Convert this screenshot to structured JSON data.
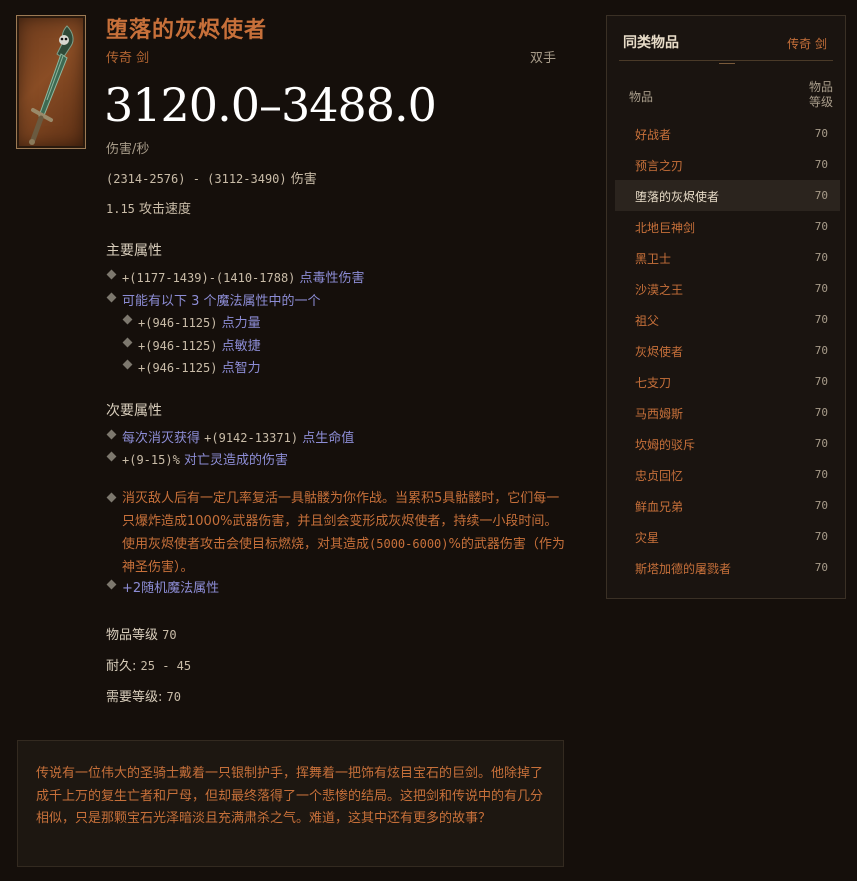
{
  "item": {
    "name": "堕落的灰烬使者",
    "subtype": "传奇 剑",
    "handedness": "双手",
    "dps": "3120.0–3488.0",
    "dps_label": "伤害/秒",
    "damage_range": "(2314-2576) - (3112-3490)",
    "damage_label": "伤害",
    "attack_speed": "1.15",
    "attack_speed_label": "攻击速度"
  },
  "primary": {
    "title": "主要属性",
    "poison": {
      "value": "+(1177-1439)-(1410-1788)",
      "text": "点毒性伤害"
    },
    "choice_text": "可能有以下 3 个魔法属性中的一个",
    "choices": [
      {
        "value": "+(946-1125)",
        "text": "点力量"
      },
      {
        "value": "+(946-1125)",
        "text": "点敏捷"
      },
      {
        "value": "+(946-1125)",
        "text": "点智力"
      }
    ]
  },
  "secondary": {
    "title": "次要属性",
    "life": {
      "text_a": "每次消灭获得",
      "value": "+(9142-13371)",
      "text_b": "点生命值"
    },
    "undead": {
      "value": "+(9-15)%",
      "text": "对亡灵造成的伤害"
    }
  },
  "legendary": {
    "text_1": "消灭敌人后有一定几率复活一具骷髅为你作战。当累积5具骷髅时，它们每一只爆炸造成1000%武器伤害，并且剑会变形成灰烬使者，持续一小段时间。使用灰烬使者攻击会使目标燃烧，对其造成",
    "value": "(5000-6000)",
    "text_2": "%的武器伤害（作为神圣伤害）。",
    "random_affixes": "+2随机魔法属性"
  },
  "meta": {
    "ilvl_label": "物品等级",
    "ilvl": "70",
    "durability_label": "耐久:",
    "durability": "25 - 45",
    "req_label": "需要等级:",
    "req": "70"
  },
  "lore": "传说有一位伟大的圣骑士戴着一只银制护手，挥舞着一把饰有炫目宝石的巨剑。他除掉了成千上万的复生亡者和尸母，但却最终落得了一个悲惨的结局。这把剑和传说中的有几分相似，只是那颗宝石光泽暗淡且充满肃杀之气。难道，这其中还有更多的故事？",
  "sidebar": {
    "title": "同类物品",
    "category": "传奇 剑",
    "col_item": "物品",
    "col_level": "物品等级",
    "items": [
      {
        "name": "好战者",
        "level": "70"
      },
      {
        "name": "预言之刃",
        "level": "70"
      },
      {
        "name": "堕落的灰烬使者",
        "level": "70"
      },
      {
        "name": "北地巨神剑",
        "level": "70"
      },
      {
        "name": "黑卫士",
        "level": "70"
      },
      {
        "name": "沙漠之王",
        "level": "70"
      },
      {
        "name": "祖父",
        "level": "70"
      },
      {
        "name": "灰烬使者",
        "level": "70"
      },
      {
        "name": "七支刀",
        "level": "70"
      },
      {
        "name": "马西姆斯",
        "level": "70"
      },
      {
        "name": "坎姆的驳斥",
        "level": "70"
      },
      {
        "name": "忠贞回忆",
        "level": "70"
      },
      {
        "name": "鲜血兄弟",
        "level": "70"
      },
      {
        "name": "灾星",
        "level": "70"
      },
      {
        "name": "斯塔加德的屠戮者",
        "level": "70"
      }
    ]
  },
  "colors": {
    "legendary": "#c7703a",
    "magic": "#8d8dd6",
    "background": "#150f0b"
  },
  "icons": [
    "legendary-sword-icon",
    "diamond-bullet-icon"
  ]
}
